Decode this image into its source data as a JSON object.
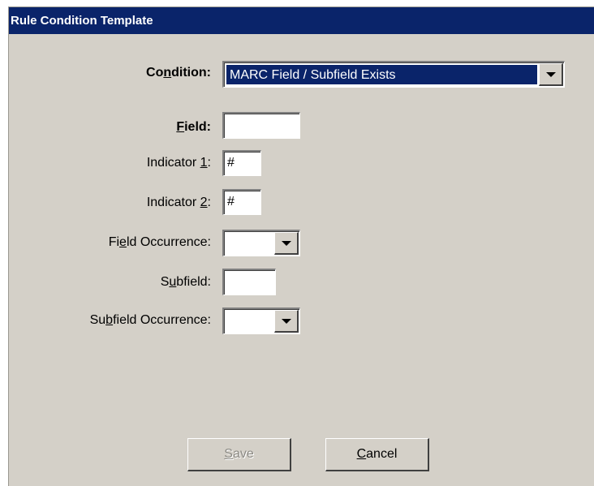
{
  "window": {
    "title": "Rule Condition Template"
  },
  "form": {
    "condition": {
      "label_pre": "Co",
      "label_key": "n",
      "label_post": "dition:",
      "value": "MARC Field / Subfield Exists"
    },
    "field": {
      "label_pre": "",
      "label_key": "F",
      "label_post": "ield:",
      "value": ""
    },
    "indicator1": {
      "label_pre": "Indicator ",
      "label_key": "1",
      "label_post": ":",
      "value": "#"
    },
    "indicator2": {
      "label_pre": "Indicator ",
      "label_key": "2",
      "label_post": ":",
      "value": "#"
    },
    "field_occurrence": {
      "label_pre": "Fi",
      "label_key": "e",
      "label_post": "ld Occurrence:",
      "value": ""
    },
    "subfield": {
      "label_pre": "S",
      "label_key": "u",
      "label_post": "bfield:",
      "value": ""
    },
    "subfield_occurrence": {
      "label_pre": "Su",
      "label_key": "b",
      "label_post": "field Occurrence:",
      "value": ""
    }
  },
  "buttons": {
    "save": {
      "pre": "",
      "key": "S",
      "post": "ave",
      "enabled": false
    },
    "cancel": {
      "pre": "",
      "key": "C",
      "post": "ancel",
      "enabled": true
    }
  },
  "icons": {
    "dropdown": "chevron-down-icon"
  },
  "colors": {
    "titlebar": "#0a246a",
    "panel": "#d4d0c8",
    "selection": "#0a246a"
  }
}
